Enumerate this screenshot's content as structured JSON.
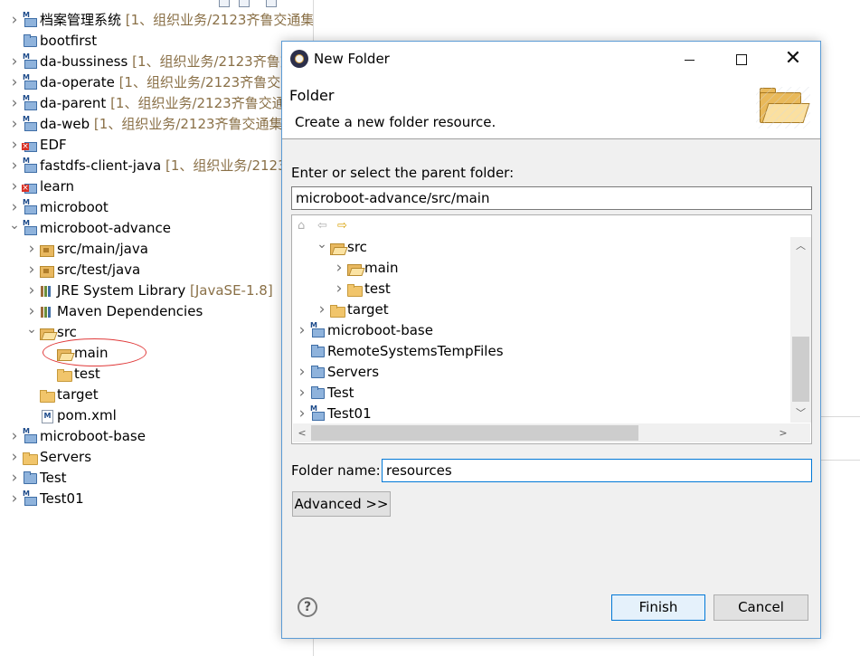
{
  "explorer": {
    "items": [
      {
        "label": "档案管理系统",
        "decoration": " [1、组织业务/2123齐鲁交通集",
        "icon": "maven-project-icon",
        "twisty": ">"
      },
      {
        "label": "bootfirst",
        "decoration": "",
        "icon": "project-folder-icon",
        "twisty": ""
      },
      {
        "label": "da-bussiness",
        "decoration": " [1、组织业务/2123齐鲁交",
        "icon": "maven-project-icon",
        "twisty": ">"
      },
      {
        "label": "da-operate",
        "decoration": " [1、组织业务/2123齐鲁交",
        "icon": "maven-project-icon",
        "twisty": ">"
      },
      {
        "label": "da-parent",
        "decoration": " [1、组织业务/2123齐鲁交通",
        "icon": "maven-project-icon",
        "twisty": ">"
      },
      {
        "label": "da-web",
        "decoration": " [1、组织业务/2123齐鲁交通集",
        "icon": "maven-project-icon",
        "twisty": ">"
      },
      {
        "label": "EDF",
        "decoration": "",
        "icon": "error-project-icon",
        "twisty": ">"
      },
      {
        "label": "fastdfs-client-java",
        "decoration": " [1、组织业务/2123",
        "icon": "maven-project-icon",
        "twisty": ">"
      },
      {
        "label": "learn",
        "decoration": "",
        "icon": "error-project-icon",
        "twisty": ">"
      },
      {
        "label": "microboot",
        "decoration": "",
        "icon": "maven-project-icon",
        "twisty": ">"
      },
      {
        "label": "microboot-advance",
        "decoration": "",
        "icon": "maven-project-icon",
        "twisty": "v"
      },
      {
        "label": "src/main/java",
        "decoration": "",
        "icon": "source-folder-icon",
        "twisty": ">"
      },
      {
        "label": "src/test/java",
        "decoration": "",
        "icon": "source-folder-icon",
        "twisty": ">"
      },
      {
        "label": "JRE System Library",
        "decoration": " [JavaSE-1.8]",
        "icon": "library-icon",
        "twisty": ">"
      },
      {
        "label": "Maven Dependencies",
        "decoration": "",
        "icon": "library-icon",
        "twisty": ">"
      },
      {
        "label": "src",
        "decoration": "",
        "icon": "open-folder-icon",
        "twisty": "v"
      },
      {
        "label": "main",
        "decoration": "",
        "icon": "open-folder-icon",
        "twisty": ""
      },
      {
        "label": "test",
        "decoration": "",
        "icon": "folder-icon",
        "twisty": ""
      },
      {
        "label": "target",
        "decoration": "",
        "icon": "folder-icon",
        "twisty": ""
      },
      {
        "label": "pom.xml",
        "decoration": "",
        "icon": "xml-file-icon",
        "twisty": ""
      },
      {
        "label": "microboot-base",
        "decoration": "",
        "icon": "maven-project-icon",
        "twisty": ">"
      },
      {
        "label": "Servers",
        "decoration": "",
        "icon": "folder-icon",
        "twisty": ">"
      },
      {
        "label": "Test",
        "decoration": "",
        "icon": "project-folder-icon",
        "twisty": ">"
      },
      {
        "label": "Test01",
        "decoration": "",
        "icon": "maven-project-icon",
        "twisty": ">"
      }
    ]
  },
  "dialog": {
    "title": "New Folder",
    "banner_title": "Folder",
    "banner_description": "Create a new folder resource.",
    "parent_label": "Enter or select the parent folder:",
    "parent_value": "microboot-advance/src/main",
    "tree": [
      {
        "label": "src",
        "icon": "open-folder-icon",
        "twisty": "v"
      },
      {
        "label": "main",
        "icon": "open-folder-icon",
        "twisty": ">",
        "selected": true
      },
      {
        "label": "test",
        "icon": "folder-icon",
        "twisty": ">"
      },
      {
        "label": "target",
        "icon": "folder-icon",
        "twisty": ">"
      },
      {
        "label": "microboot-base",
        "icon": "maven-project-icon",
        "twisty": ">"
      },
      {
        "label": "RemoteSystemsTempFiles",
        "icon": "project-folder-icon",
        "twisty": ""
      },
      {
        "label": "Servers",
        "icon": "project-folder-icon",
        "twisty": ">"
      },
      {
        "label": "Test",
        "icon": "project-folder-icon",
        "twisty": ">"
      },
      {
        "label": "Test01",
        "icon": "maven-project-icon",
        "twisty": ">"
      }
    ],
    "folder_name_label": "Folder name:",
    "folder_name_value": "resources",
    "advanced_label": "Advanced >>",
    "finish_label": "Finish",
    "cancel_label": "Cancel",
    "help_glyph": "?"
  },
  "colors": {
    "accent": "#0078d7",
    "annotation": "#e03a3a",
    "decoration_text": "#8a7047"
  }
}
